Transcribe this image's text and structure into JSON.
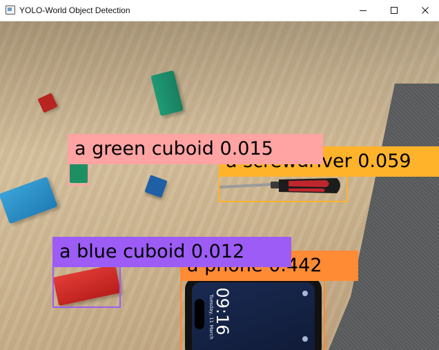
{
  "window": {
    "title": "YOLO-World Object Detection",
    "controls": {
      "minimize": "minimize-icon",
      "maximize": "maximize-icon",
      "close": "close-icon"
    }
  },
  "detections": [
    {
      "label": "a screwdriver 0.059",
      "color": "#ffb32b"
    },
    {
      "label": "a green cuboid 0.015",
      "color": "#ffa3a3"
    },
    {
      "label": "a phone 0.442",
      "color": "#ff8b35"
    },
    {
      "label": "a blue cuboid 0.012",
      "color": "#9c5cf5"
    }
  ],
  "phone_screen": {
    "time": "09:16",
    "date": "Tuesday, 11 March"
  }
}
